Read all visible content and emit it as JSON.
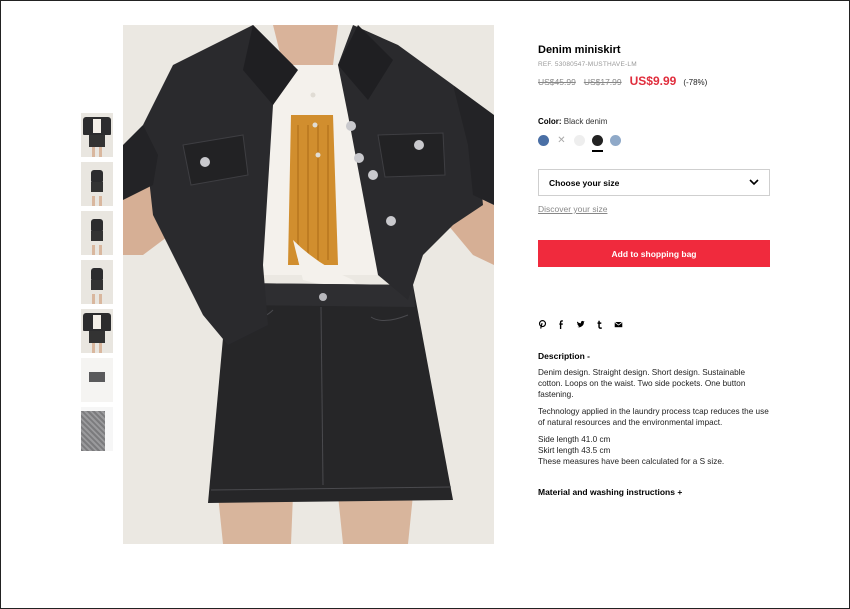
{
  "product": {
    "title": "Denim miniskirt",
    "ref": "REF. 53080547-MUSTHAVE-LM",
    "price_original_1": "US$45.99",
    "price_original_2": "US$17.99",
    "price_current": "US$9.99",
    "discount": "(-78%)"
  },
  "color": {
    "label": "Color:",
    "value": "Black denim",
    "swatches": [
      {
        "name": "blue",
        "hex": "#4a6fa5"
      },
      {
        "name": "unavailable",
        "hex": "#ffffff"
      },
      {
        "name": "white",
        "hex": "#eeeeee"
      },
      {
        "name": "black",
        "hex": "#222222",
        "selected": true
      },
      {
        "name": "light-blue",
        "hex": "#8fa9c8"
      }
    ]
  },
  "size": {
    "select_label": "Choose your size",
    "discover_link": "Discover your size"
  },
  "cart": {
    "add_label": "Add to shopping bag"
  },
  "social": [
    "pinterest-icon",
    "facebook-icon",
    "twitter-icon",
    "tumblr-icon",
    "email-icon"
  ],
  "description": {
    "heading": "Description -",
    "p1": "Denim design. Straight design. Short design. Sustainable cotton. Loops on the waist. Two side pockets. One button fastening.",
    "p2": "Technology applied in the laundry process tcap reduces the use of natural resources and the environmental impact.",
    "side_length": "Side length 41.0 cm",
    "skirt_length": "Skirt length 43.5 cm",
    "measure_note": "These measures have been calculated for a S size."
  },
  "materials": {
    "heading": "Material and washing instructions +"
  },
  "colors": {
    "accent": "#f02a3d",
    "price_red": "#e02d3c"
  }
}
